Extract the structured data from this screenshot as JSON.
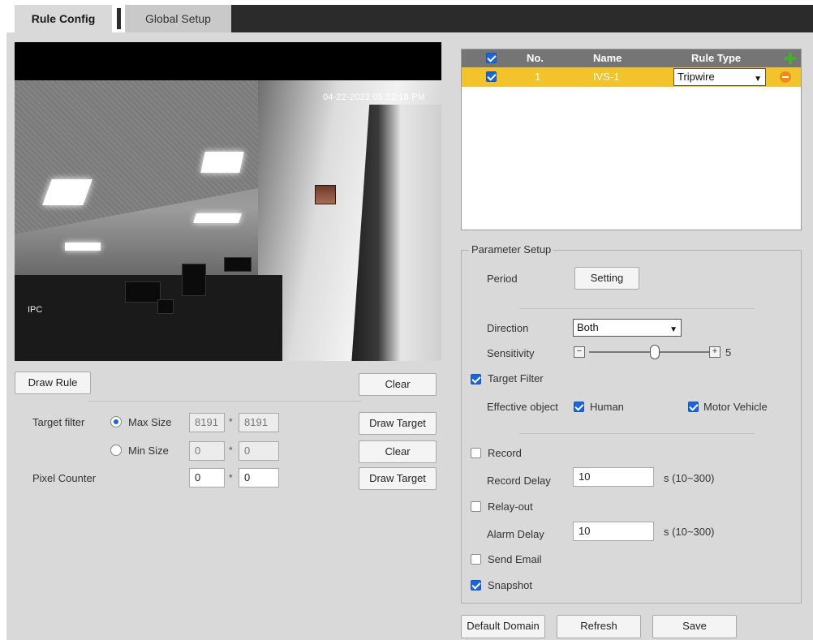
{
  "tabs": {
    "rule_config": "Rule Config",
    "global_setup": "Global Setup"
  },
  "video": {
    "timestamp": "04-22-2022 05:22:18 PM",
    "corner_label": "IPC"
  },
  "left": {
    "draw_rule": "Draw Rule",
    "clear": "Clear",
    "target_filter_label": "Target filter",
    "max_size_label": "Max Size",
    "max_w": "8191",
    "max_h": "8191",
    "min_size_label": "Min Size",
    "min_w": "0",
    "min_h": "0",
    "draw_target": "Draw Target",
    "clear2": "Clear",
    "pixel_counter_label": "Pixel Counter",
    "pix_w": "0",
    "pix_h": "0",
    "draw_target2": "Draw Target",
    "star": "*"
  },
  "rules_table": {
    "headers": {
      "no": "No.",
      "name": "Name",
      "rule_type": "Rule Type"
    },
    "rows": [
      {
        "checked": true,
        "no": "1",
        "name": "IVS-1",
        "rule_type": "Tripwire"
      }
    ]
  },
  "params": {
    "legend": "Parameter Setup",
    "period_label": "Period",
    "setting_button": "Setting",
    "direction_label": "Direction",
    "direction_value": "Both",
    "sensitivity_label": "Sensitivity",
    "sensitivity_value": "5",
    "sensitivity_level_fraction": 0.55,
    "target_filter": "Target Filter",
    "effective_object_label": "Effective object",
    "human": "Human",
    "motor_vehicle": "Motor Vehicle",
    "record": "Record",
    "record_delay_label": "Record Delay",
    "record_delay_value": "10",
    "record_delay_range": "s (10~300)",
    "relay_out": "Relay-out",
    "alarm_delay_label": "Alarm Delay",
    "alarm_delay_value": "10",
    "alarm_delay_range": "s (10~300)",
    "send_email": "Send Email",
    "snapshot": "Snapshot",
    "minus_sign": "−",
    "plus_sign": "+"
  },
  "footer": {
    "default_domain": "Default Domain",
    "refresh": "Refresh",
    "save": "Save"
  },
  "colors": {
    "accent": "#1a66d9",
    "row_highlight": "#f3c32b",
    "header_bg": "#757575",
    "panel_bg": "#d9d9d9"
  }
}
